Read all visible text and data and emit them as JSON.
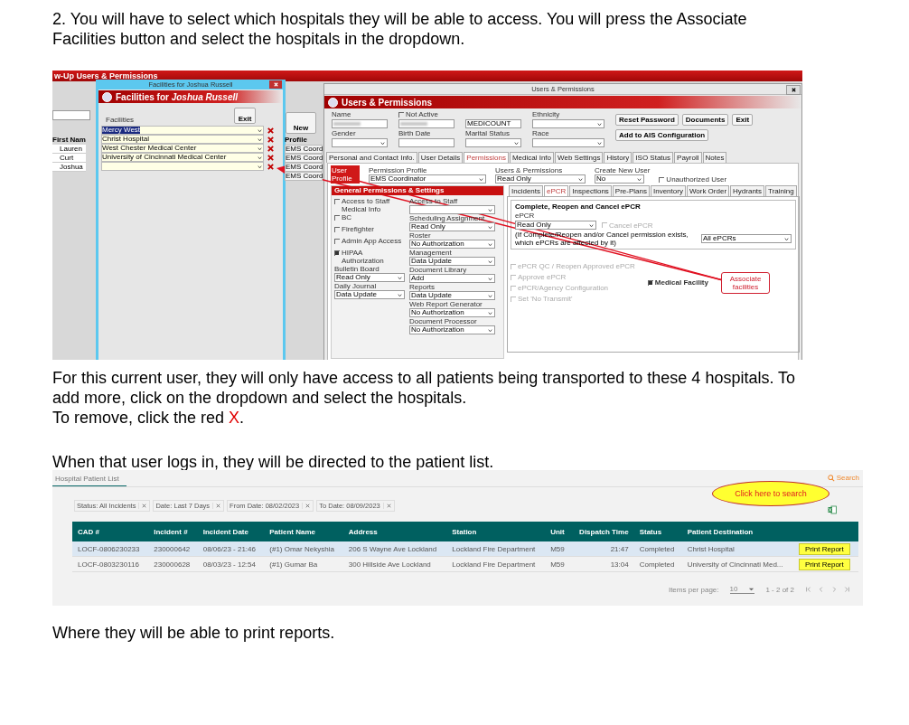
{
  "instruction": "2. You will have to select which hospitals they will be able to access. You will press the Associate Facilities button and select the hospitals in the dropdown.",
  "admin_screenshot": {
    "main_title": "w-Up Users & Permissions",
    "new_button": "New",
    "first_name_header": "First Nam",
    "first_names": [
      "Lauren",
      "Curt",
      "Joshua"
    ],
    "profile_header": "Profile",
    "profiles": [
      "EMS Coord",
      "EMS Coord",
      "EMS Coord",
      "EMS Coord"
    ],
    "facilities_window": {
      "title": "Facilities for Joshua Russell",
      "banner_prefix": "Facilities for ",
      "banner_name": "Joshua Russell",
      "label": "Facilities",
      "exit_button": "Exit",
      "facilities": [
        {
          "name": "Mercy West",
          "selected": true
        },
        {
          "name": "Christ Hospital",
          "selected": false
        },
        {
          "name": "West Chester Medical Center",
          "selected": false
        },
        {
          "name": "University of Cincinnati Medical Center",
          "selected": false
        }
      ]
    },
    "users_window": {
      "title": "Users & Permissions",
      "banner": "Users & Permissions",
      "not_active": {
        "label": "Not Active",
        "checked": false
      },
      "name_label": "Name",
      "code_value": "MEDICOUNT",
      "ethnicity_label": "Ethnicity",
      "gender_label": "Gender",
      "birth_date_label": "Birth Date",
      "marital_status_label": "Marital Status",
      "race_label": "Race",
      "buttons": [
        "Reset Password",
        "Documents",
        "Exit",
        "Add to AIS Configuration"
      ],
      "tabs": [
        {
          "label": "Personal and Contact Info.",
          "selected": false
        },
        {
          "label": "User Details",
          "selected": false
        },
        {
          "label": "Permissions",
          "selected": true
        },
        {
          "label": "Medical Info",
          "selected": false
        },
        {
          "label": "Web Settings",
          "selected": false
        },
        {
          "label": "History",
          "selected": false
        },
        {
          "label": "ISO Status",
          "selected": false
        },
        {
          "label": "Payroll",
          "selected": false
        },
        {
          "label": "Notes",
          "selected": false
        }
      ],
      "user_profile_label": "User Profile",
      "permission_profile": {
        "label": "Permission Profile",
        "value": "EMS Coordinator"
      },
      "users_permissions": {
        "label": "Users & Permissions",
        "value": "Read Only"
      },
      "create_new_user": {
        "label": "Create New User",
        "value": "No"
      },
      "unauthorized_user": {
        "label": "Unauthorized User",
        "checked": false
      },
      "general_header": "General Permissions & Settings",
      "left_checks": [
        {
          "label": "Access to Staff Medical Info",
          "checked": false
        },
        {
          "label": "BC",
          "checked": false
        },
        {
          "label": "Firefighter",
          "checked": false
        },
        {
          "label": "Admin App Access",
          "checked": false
        },
        {
          "label": "HIPAA Authorization",
          "checked": true
        }
      ],
      "left_selects": [
        {
          "label": "Bulletin Board",
          "value": "Read Only"
        },
        {
          "label": "Daily Journal",
          "value": "Data Update"
        }
      ],
      "middle_selects": [
        {
          "label": "Access to Staff"
        },
        {
          "label": "Scheduling Assignment",
          "value": "Read Only"
        },
        {
          "label": "Roster",
          "value": "No Authorization"
        },
        {
          "label": "Management",
          "value": "Data Update"
        },
        {
          "label": "Document Library",
          "value": "Add"
        },
        {
          "label": "Reports",
          "value": "Data Update"
        },
        {
          "label": "Web Report Generator",
          "value": "No Authorization"
        },
        {
          "label": "Document Processor",
          "value": "No Authorization"
        }
      ],
      "sub_tabs": [
        {
          "label": "Incidents",
          "selected": false
        },
        {
          "label": "ePCR",
          "selected": true
        },
        {
          "label": "Inspections",
          "selected": false
        },
        {
          "label": "Pre-Plans",
          "selected": false
        },
        {
          "label": "Inventory",
          "selected": false
        },
        {
          "label": "Work Order",
          "selected": false
        },
        {
          "label": "Hydrants",
          "selected": false
        },
        {
          "label": "Training",
          "selected": false
        }
      ],
      "epcr_group": {
        "title": "Complete, Reopen and Cancel ePCR",
        "select_label": "ePCR",
        "select_value": "Read Only",
        "cancel": {
          "label": "Cancel ePCR",
          "checked": false,
          "disabled": true
        },
        "note": "(If Complete/Reopen and/or Cancel permission exists, which ePCRs are affected by it)",
        "scope_value": "All ePCRs"
      },
      "epcr_checks": [
        {
          "label": "ePCR QC / Reopen Approved ePCR",
          "checked": false,
          "disabled": true
        },
        {
          "label": "Approve ePCR",
          "checked": false,
          "disabled": true
        },
        {
          "label": "ePCR/Agency Configuration",
          "checked": false,
          "disabled": true
        },
        {
          "label": "Set 'No Transmit'",
          "checked": false,
          "disabled": true
        }
      ],
      "medical_facility": {
        "label": "Medical Facility",
        "checked": true
      },
      "callout": "Associate facilities"
    }
  },
  "explanation": "For this current user, they will only have access to all patients being transported to these 4 hospitals. To add more, click on the dropdown and select the hospitals.",
  "remove_line": {
    "before": "To remove, click the red ",
    "highlight": "X",
    "after": "."
  },
  "login_text": "When that user logs in, they will be directed to the patient list.",
  "patient_list": {
    "tab": "Hospital Patient List",
    "search": "Search",
    "callout": "Click here to search",
    "filters": [
      "Status: All Incidents",
      "Date: Last 7 Days",
      "From Date: 08/02/2023",
      "To Date: 08/09/2023"
    ],
    "columns": [
      "CAD #",
      "Incident #",
      "Incident Date",
      "Patient Name",
      "Address",
      "Station",
      "Unit",
      "Dispatch Time",
      "Status",
      "Patient Destination"
    ],
    "rows": [
      {
        "cells": [
          "LOCF-0806230233",
          "230000642",
          "08/06/23 - 21:46",
          "(#1) Omar Nekyshia",
          "206 S Wayne Ave Lockland",
          "Lockland Fire Department",
          "M59",
          "21:47",
          "Completed",
          "Christ Hospital"
        ],
        "action": "Print Report",
        "selected": true
      },
      {
        "cells": [
          "LOCF-0803230116",
          "230000628",
          "08/03/23 - 12:54",
          "(#1) Gumar Ba",
          "300 Hillside Ave Lockland",
          "Lockland Fire Department",
          "M59",
          "13:04",
          "Completed",
          "University of Cincinnati Med..."
        ],
        "action": "Print Report",
        "selected": false
      }
    ],
    "items_per_page_label": "Items per page:",
    "items_per_page": "10",
    "range": "1 - 2 of 2"
  },
  "closing_text": "Where they will be able to print reports."
}
